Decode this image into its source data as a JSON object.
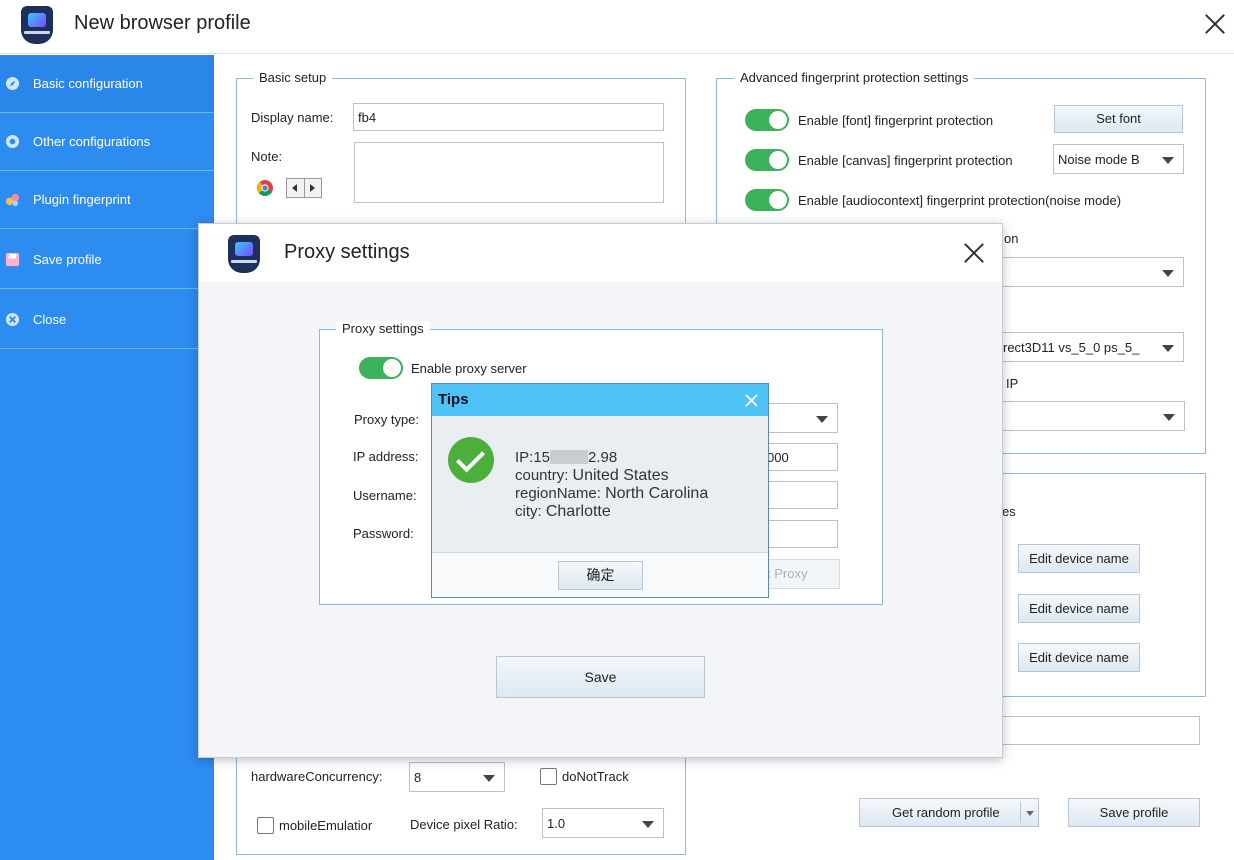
{
  "window": {
    "title": "New browser profile"
  },
  "sidebar": {
    "items": [
      {
        "label": "Basic configuration"
      },
      {
        "label": "Other configurations"
      },
      {
        "label": "Plugin fingerprint"
      },
      {
        "label": "Save profile"
      },
      {
        "label": "Close"
      }
    ]
  },
  "basic_setup": {
    "title": "Basic setup",
    "display_name_label": "Display name:",
    "display_name_value": "fb4",
    "note_label": "Note:"
  },
  "advanced": {
    "title": "Advanced fingerprint protection settings",
    "font_label": "Enable [font] fingerprint protection",
    "set_font_button": "Set font",
    "canvas_label": "Enable [canvas] fingerprint protection",
    "canvas_mode": "Noise mode B",
    "audio_label": "Enable [audiocontext] fingerprint  protection(noise mode)",
    "partial_on": "on",
    "partial_webgl": "rect3D11 vs_5_0 ps_5_",
    "partial_ip": "IP",
    "partial_es": "es"
  },
  "devices": {
    "edit_button_1": "Edit device name",
    "edit_button_2": "Edit device name",
    "edit_button_3": "Edit device name"
  },
  "hardware": {
    "concurrency_label": "hardwareConcurrency:",
    "concurrency_value": "8",
    "do_not_track_label": "doNotTrack",
    "mobile_label": "mobileEmulatior",
    "pixel_ratio_label": "Device pixel Ratio:",
    "pixel_ratio_value": "1.0"
  },
  "bottom_buttons": {
    "random_profile": "Get random profile",
    "save_profile": "Save profile"
  },
  "proxy_dialog": {
    "title": "Proxy settings",
    "group_title": "Proxy settings",
    "enable_label": "Enable proxy server",
    "type_label": "Proxy type:",
    "ip_label": "IP address:",
    "port_partial": "000",
    "username_label": "Username:",
    "password_label": "Password:",
    "test_partial": "t Proxy",
    "save_button": "Save"
  },
  "tips_dialog": {
    "title": "Tips",
    "ip_prefix": "IP:15",
    "ip_suffix": "2.98",
    "country_key": "country:",
    "country_value": "United States",
    "region_key": "regionName:",
    "region_value": "North Carolina",
    "city_key": "city:",
    "city_value": "Charlotte",
    "ok_button": "确定"
  },
  "colors": {
    "sidebar": "#2d8cf0",
    "toggle_on": "#3bb25a",
    "tips_header": "#4fc3f7",
    "success": "#4caf3c"
  }
}
